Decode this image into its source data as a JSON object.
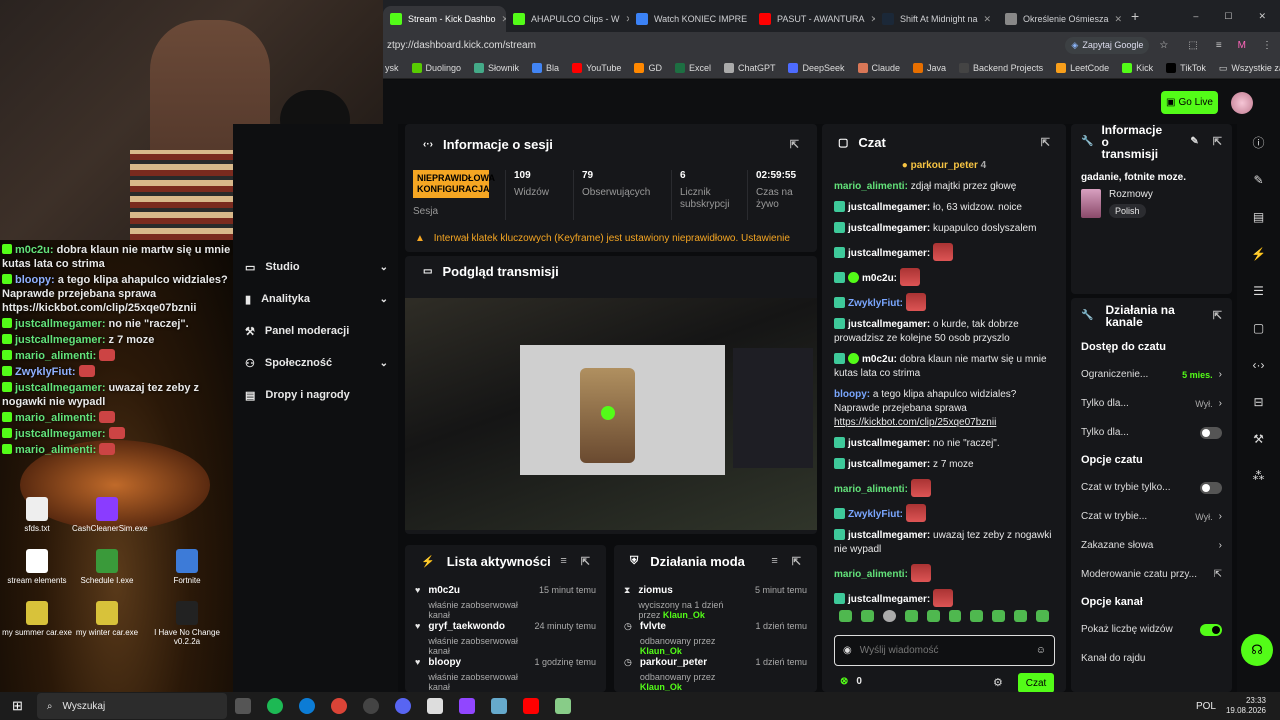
{
  "browser": {
    "tabs": [
      {
        "label": "Stream - Kick Dashbo",
        "color": "#53fc18",
        "active": true
      },
      {
        "label": "AHAPULCO Clips - W",
        "color": "#53fc18",
        "active": false
      },
      {
        "label": "Watch KONIEC IMPRE",
        "color": "#3b82f6",
        "active": false
      },
      {
        "label": "PASUT - AWANTURA",
        "color": "#ff0000",
        "active": false
      },
      {
        "label": "Shift At Midnight na",
        "color": "#1b2838",
        "active": false
      },
      {
        "label": "Określenie Ośmiesza",
        "color": "#888888",
        "active": false
      }
    ],
    "url": "ztpy://dashboard.kick.com/stream",
    "google_label": "Zapytaj Google",
    "bookmarks": [
      "ysk",
      "Duolingo",
      "Słownik",
      "Bla",
      "YouTube",
      "GD",
      "Excel",
      "ChatGPT",
      "DeepSeek",
      "Claude",
      "Java",
      "Backend Projects",
      "LeetCode",
      "Kick",
      "TikTok"
    ],
    "all_bookmarks": "Wszystkie zakładki"
  },
  "kick": {
    "go_live": "Go Live"
  },
  "overlay_chat": [
    {
      "user": "m0c2u:",
      "text": "dobra klaun nie martw się u mnie kutas lata co strima"
    },
    {
      "user": "bloopy:",
      "text": "a tego klipa ahapulco widziales? Naprawde przejebana sprawa https://kickbot.com/clip/25xqe07bznii"
    },
    {
      "user": "justcallmegamer:",
      "text": "no nie \"raczej\"."
    },
    {
      "user": "justcallmegamer:",
      "text": "z 7 moze"
    },
    {
      "user": "mario_alimenti:",
      "text": ""
    },
    {
      "user": "ZwyklyFiut:",
      "text": ""
    },
    {
      "user": "justcallmegamer:",
      "text": "uwazaj tez zeby z nogawki nie wypadl"
    },
    {
      "user": "mario_alimenti:",
      "text": ""
    },
    {
      "user": "justcallmegamer:",
      "text": ""
    },
    {
      "user": "mario_alimenti:",
      "text": ""
    }
  ],
  "desktop_icons": [
    {
      "label": "sfds.txt",
      "color": "#eeeeee"
    },
    {
      "label": "CashCleanerSim.exe",
      "color": "#8a3cff"
    },
    {
      "label": "stream elements",
      "color": "#ffffff"
    },
    {
      "label": "Schedule I.exe",
      "color": "#3a9a3a"
    },
    {
      "label": "Fortnite",
      "color": "#3d7bd8"
    },
    {
      "label": "my summer car.exe",
      "color": "#d8c23a"
    },
    {
      "label": "my winter car.exe",
      "color": "#d8c23a"
    },
    {
      "label": "I Have No Change v0.2.2a",
      "color": "#222222"
    }
  ],
  "nav": {
    "items": [
      {
        "label": "Studio",
        "chevron": true
      },
      {
        "label": "Analityka",
        "chevron": true
      },
      {
        "label": "Panel moderacji",
        "chevron": false
      },
      {
        "label": "Społeczność",
        "chevron": true
      },
      {
        "label": "Dropy i nagrody",
        "chevron": false
      }
    ]
  },
  "session": {
    "title": "Informacje o sesji",
    "badge": "NIEPRAWIDŁOWA KONFIGURACJA",
    "badge_label": "Sesja",
    "stats": [
      {
        "num": "109",
        "label": "Widzów"
      },
      {
        "num": "79",
        "label": "Obserwujących"
      },
      {
        "num": "6",
        "label": "Licznik subskrypcji"
      },
      {
        "num": "02:59:55",
        "label": "Czas na żywo"
      }
    ],
    "warning": "Interwał klatek kluczowych (Keyframe) jest ustawiony nieprawidłowo. Ustawienie"
  },
  "preview": {
    "title": "Podgląd transmisji"
  },
  "activity": {
    "title": "Lista aktywności",
    "items": [
      {
        "name": "m0c2u",
        "sub": "właśnie zaobserwował kanał",
        "time": "15 minut temu"
      },
      {
        "name": "gryf_taekwondo",
        "sub": "właśnie zaobserwował kanał",
        "time": "24 minuty temu"
      },
      {
        "name": "bloopy",
        "sub": "właśnie zaobserwował kanał",
        "time": "1 godzinę temu"
      }
    ]
  },
  "modactions": {
    "title": "Działania moda",
    "items": [
      {
        "name": "ziomus",
        "sub": "wyciszony na 1 dzień przez",
        "by": "Klaun_Ok",
        "time": "5 minut temu"
      },
      {
        "name": "fvlvte",
        "sub": "odbanowany przez",
        "by": "Klaun_Ok",
        "time": "1 dzień temu"
      },
      {
        "name": "parkour_peter",
        "sub": "odbanowany przez",
        "by": "Klaun_Ok",
        "time": "1 dzień temu"
      }
    ]
  },
  "chat": {
    "title": "Czat",
    "pinned_user": "parkour_peter",
    "pinned_count": "4",
    "messages": [
      {
        "user": "mario_alimenti:",
        "color": "green",
        "badge": "none",
        "text": "zdjął majtki przez głowę",
        "emote": false
      },
      {
        "user": "justcallmegamer:",
        "color": "white",
        "badge": "kick",
        "text": "ło, 63 widzow. noice",
        "emote": false
      },
      {
        "user": "justcallmegamer:",
        "color": "white",
        "badge": "kick",
        "text": "kupapulco doslyszalem",
        "emote": false
      },
      {
        "user": "justcallmegamer:",
        "color": "white",
        "badge": "kick",
        "text": "",
        "emote": true
      },
      {
        "user": "m0c2u:",
        "color": "white",
        "badge": "kickv",
        "text": "",
        "emote": true
      },
      {
        "user": "ZwyklyFiut:",
        "color": "blue",
        "badge": "kick",
        "text": "",
        "emote": true
      },
      {
        "user": "justcallmegamer:",
        "color": "white",
        "badge": "kick",
        "text": "o kurde, tak dobrze prowadzisz ze kolejne 50 osob przyszlo",
        "emote": false
      },
      {
        "user": "m0c2u:",
        "color": "white",
        "badge": "kickv",
        "text": "dobra klaun nie martw się u mnie kutas lata co strima",
        "emote": false
      },
      {
        "user": "bloopy:",
        "color": "blue",
        "badge": "none",
        "text": "a tego klipa ahapulco widziales? Naprawde przejebana sprawa https://kickbot.com/clip/25xqe07bznii",
        "emote": false
      },
      {
        "user": "justcallmegamer:",
        "color": "white",
        "badge": "kick",
        "text": "no nie \"raczej\".",
        "emote": false
      },
      {
        "user": "justcallmegamer:",
        "color": "white",
        "badge": "kick",
        "text": "z 7 moze",
        "emote": false
      },
      {
        "user": "mario_alimenti:",
        "color": "green",
        "badge": "none",
        "text": "",
        "emote": true
      },
      {
        "user": "ZwyklyFiut:",
        "color": "blue",
        "badge": "kick",
        "text": "",
        "emote": true
      },
      {
        "user": "justcallmegamer:",
        "color": "white",
        "badge": "kick",
        "text": "uwazaj tez zeby z nogawki nie wypadl",
        "emote": false
      },
      {
        "user": "mario_alimenti:",
        "color": "green",
        "badge": "none",
        "text": "",
        "emote": true
      },
      {
        "user": "justcallmegamer:",
        "color": "white",
        "badge": "kick",
        "text": "",
        "emote": true
      },
      {
        "user": "mario_alimenti:",
        "color": "green",
        "badge": "none",
        "text": "",
        "emote": true
      }
    ],
    "input_placeholder": "Wyślij wiadomość",
    "points": "0",
    "send_label": "Czat"
  },
  "stream_info": {
    "title": "Informacje o transmisji",
    "stream_title": "gadanie, fotnite moze.",
    "category": "Rozmowy",
    "language": "Polish"
  },
  "channel_actions": {
    "title": "Działania na kanale",
    "sections": [
      {
        "heading": "Dostęp do czatu",
        "rows": [
          {
            "label": "Ograniczenie...",
            "value": "5 mies.",
            "type": "arrow",
            "accent": true
          },
          {
            "label": "Tylko dla...",
            "value": "Wył.",
            "type": "arrow",
            "accent": false
          },
          {
            "label": "Tylko dla...",
            "value": "",
            "type": "toggle-off",
            "accent": false
          }
        ]
      },
      {
        "heading": "Opcje czatu",
        "rows": [
          {
            "label": "Czat w trybie tylko...",
            "value": "",
            "type": "toggle-off",
            "accent": false
          },
          {
            "label": "Czat w trybie...",
            "value": "Wył.",
            "type": "arrow",
            "accent": false
          },
          {
            "label": "Zakazane słowa",
            "value": "",
            "type": "arrow",
            "accent": false
          },
          {
            "label": "Moderowanie czatu przy...",
            "value": "",
            "type": "external",
            "accent": false
          }
        ]
      },
      {
        "heading": "Opcje kanał",
        "rows": [
          {
            "label": "Pokaż liczbę widzów",
            "value": "",
            "type": "toggle-on",
            "accent": false
          },
          {
            "label": "Kanał do rajdu",
            "value": "",
            "type": "none",
            "accent": false
          }
        ]
      }
    ]
  },
  "taskbar": {
    "search": "Wyszukaj",
    "lang": "POL",
    "time": "23:33",
    "date": "19.08.2026"
  }
}
